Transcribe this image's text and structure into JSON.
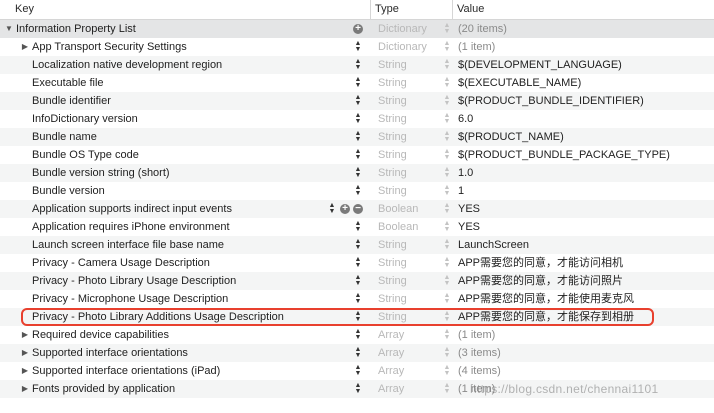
{
  "header": {
    "key": "Key",
    "type": "Type",
    "value": "Value"
  },
  "rows": [
    {
      "key": "Information Property List",
      "type": "Dictionary",
      "value": "(20 items)",
      "expander": "expanded",
      "root": true
    },
    {
      "key": "App Transport Security Settings",
      "type": "Dictionary",
      "value": "(1 item)",
      "expander": "collapsed"
    },
    {
      "key": "Localization native development region",
      "type": "String",
      "value": "$(DEVELOPMENT_LANGUAGE)"
    },
    {
      "key": "Executable file",
      "type": "String",
      "value": "$(EXECUTABLE_NAME)"
    },
    {
      "key": "Bundle identifier",
      "type": "String",
      "value": "$(PRODUCT_BUNDLE_IDENTIFIER)"
    },
    {
      "key": "InfoDictionary version",
      "type": "String",
      "value": "6.0"
    },
    {
      "key": "Bundle name",
      "type": "String",
      "value": "$(PRODUCT_NAME)"
    },
    {
      "key": "Bundle OS Type code",
      "type": "String",
      "value": "$(PRODUCT_BUNDLE_PACKAGE_TYPE)"
    },
    {
      "key": "Bundle version string (short)",
      "type": "String",
      "value": "1.0"
    },
    {
      "key": "Bundle version",
      "type": "String",
      "value": "1"
    },
    {
      "key": "Application supports indirect input events",
      "type": "Boolean",
      "value": "YES",
      "selectedControls": true
    },
    {
      "key": "Application requires iPhone environment",
      "type": "Boolean",
      "value": "YES"
    },
    {
      "key": "Launch screen interface file base name",
      "type": "String",
      "value": "LaunchScreen"
    },
    {
      "key": "Privacy - Camera Usage Description",
      "type": "String",
      "value": "APP需要您的同意，才能访问相机"
    },
    {
      "key": "Privacy - Photo Library Usage Description",
      "type": "String",
      "value": "APP需要您的同意，才能访问照片"
    },
    {
      "key": "Privacy - Microphone Usage Description",
      "type": "String",
      "value": "APP需要您的同意，才能使用麦克风"
    },
    {
      "key": "Privacy - Photo Library Additions Usage Description",
      "type": "String",
      "value": "APP需要您的同意，才能保存到相册",
      "highlighted": true
    },
    {
      "key": "Required device capabilities",
      "type": "Array",
      "value": "(1 item)",
      "expander": "collapsed"
    },
    {
      "key": "Supported interface orientations",
      "type": "Array",
      "value": "(3 items)",
      "expander": "collapsed"
    },
    {
      "key": "Supported interface orientations (iPad)",
      "type": "Array",
      "value": "(4 items)",
      "expander": "collapsed"
    },
    {
      "key": "Fonts provided by application",
      "type": "Array",
      "value": "(1 item)",
      "expander": "collapsed"
    }
  ],
  "watermark": "https://blog.csdn.net/chennai1101",
  "colors": {
    "highlight_border": "#e8402e",
    "type_text": "#b8b8b8",
    "root_row_bg": "#e4e5e6"
  },
  "icons": {
    "expanded": "disclosure-triangle-down-icon",
    "collapsed": "disclosure-triangle-right-icon",
    "stepper": "up-down-stepper-icon",
    "add": "plus-circle-icon",
    "remove": "minus-circle-icon"
  }
}
